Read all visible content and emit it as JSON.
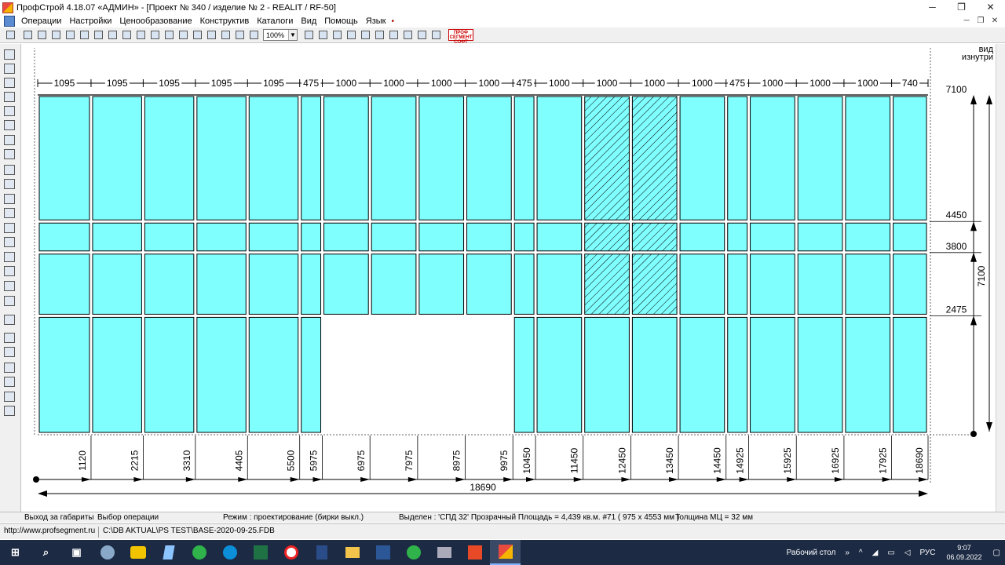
{
  "window": {
    "title": "ПрофСтрой 4.18.07 «АДМИН» - [Проект № 340 / изделие № 2  -  REALIT / RF-50]",
    "controls": {
      "minimize": "─",
      "restore": "❐",
      "close": "✕"
    }
  },
  "menu": {
    "items": [
      "Операции",
      "Настройки",
      "Ценообразование",
      "Конструктив",
      "Каталоги",
      "Вид",
      "Помощь",
      "Язык"
    ],
    "mdi": [
      "─",
      "❐",
      "✕"
    ]
  },
  "toolbar": {
    "zoom": "100%",
    "logo_lines": [
      "ПРОФ",
      "СЕГМЕНТ",
      "СОФТ"
    ]
  },
  "drawing": {
    "view_label": [
      "вид",
      "изнутри"
    ],
    "top_widths": [
      1095,
      1095,
      1095,
      1095,
      1095,
      475,
      1000,
      1000,
      1000,
      1000,
      475,
      1000,
      1000,
      1000,
      1000,
      475,
      1000,
      1000,
      1000,
      740
    ],
    "cumulative": [
      1120,
      2215,
      3310,
      4405,
      5500,
      5975,
      6975,
      7975,
      8975,
      9975,
      10450,
      11450,
      12450,
      13450,
      14450,
      14925,
      15925,
      16925,
      17925,
      18690
    ],
    "total_width": 18690,
    "total_height": 7100,
    "height_marks": [
      7100,
      4450,
      3800,
      2475
    ],
    "opening_columns": [
      6,
      7,
      8,
      9
    ],
    "hatched_columns": [
      12,
      13
    ],
    "glass_color": "#80ffff",
    "frame_color": "#000000"
  },
  "status": {
    "exit": "Выход за габариты",
    "choose": "Выбор операции",
    "mode": "Режим : проектирование  (бирки выкл.)",
    "selected": "Выделен : 'СПД 32' Прозрачный     Площадь = 4,439 кв.м.  #71 ( 975 x 4553 мм )",
    "thickness": "Толщина МЦ = 32 мм"
  },
  "pathbar": {
    "url": "http://www.profsegment.ru",
    "db": "C:\\DB AKTUAL\\PS TEST\\BASE-2020-09-25.FDB"
  },
  "taskbar": {
    "desktop": "Рабочий стол",
    "lang": "РУС",
    "time": "9:07",
    "date": "06.09.2022",
    "apps": [
      "win-start",
      "search",
      "task-view",
      "browser",
      "app-yellow",
      "files",
      "chat",
      "skype",
      "excel",
      "yandex",
      "calculator",
      "explorer",
      "word",
      "chat2",
      "tool",
      "app-s",
      "profstroy"
    ]
  }
}
